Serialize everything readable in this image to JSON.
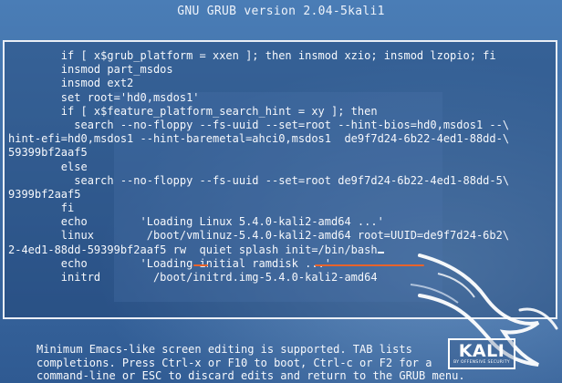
{
  "header": {
    "title": "GNU GRUB  version 2.04-5kali1"
  },
  "editor": {
    "lines": [
      "        if [ x$grub_platform = xxen ]; then insmod xzio; insmod lzopio; fi",
      "        insmod part_msdos",
      "        insmod ext2",
      "        set root='hd0,msdos1'",
      "        if [ x$feature_platform_search_hint = xy ]; then",
      "          search --no-floppy --fs-uuid --set=root --hint-bios=hd0,msdos1 --\\",
      "hint-efi=hd0,msdos1 --hint-baremetal=ahci0,msdos1  de9f7d24-6b22-4ed1-88dd-\\",
      "59399bf2aaf5",
      "        else",
      "          search --no-floppy --fs-uuid --set=root de9f7d24-6b22-4ed1-88dd-5\\",
      "9399bf2aaf5",
      "        fi",
      "        echo        'Loading Linux 5.4.0-kali2-amd64 ...'",
      "        linux        /boot/vmlinuz-5.4.0-kali2-amd64 root=UUID=de9f7d24-6b2\\",
      "2-4ed1-88dd-59399bf2aaf5 rw  quiet splash init=/bin/bash",
      "        echo        'Loading initial ramdisk ...'",
      "        initrd        /boot/initrd.img-5.4.0-kali2-amd64"
    ]
  },
  "help": {
    "lines": [
      "Minimum Emacs-like screen editing is supported. TAB lists",
      "completions. Press Ctrl-x or F10 to boot, Ctrl-c or F2 for a",
      "command-line or ESC to discard edits and return to the GRUB menu."
    ]
  },
  "logo": {
    "text": "KALI",
    "subtext": "BY OFFENSIVE SECURITY"
  },
  "colors": {
    "background": "#3f6fa6",
    "highlight": "#e8632b",
    "text": "#f6f8fc"
  }
}
